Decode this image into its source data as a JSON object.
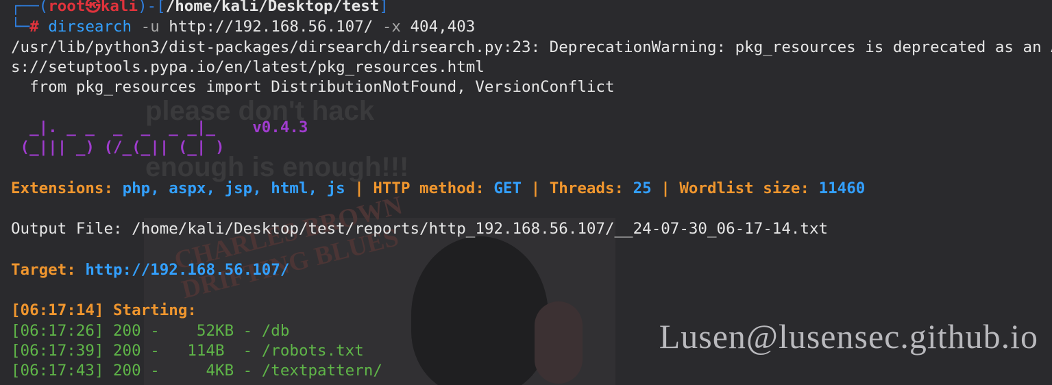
{
  "prompt": {
    "corner_top": "┌──(",
    "user": "root",
    "at_symbol": "㉿",
    "host": "kali",
    "dash_open": ")-[",
    "cwd": "/home/kali/Desktop/test",
    "close": "]",
    "corner_bottom": "└─",
    "hash": "#"
  },
  "command": {
    "program": "dirsearch",
    "flag_u": "-u",
    "url": "http://192.168.56.107/",
    "flag_x": "-x",
    "codes": "404,403"
  },
  "warning": {
    "line1": "/usr/lib/python3/dist-packages/dirsearch/dirsearch.py:23: DeprecationWarning: pkg_resources is deprecated as an API. See http",
    "line2": "s://setuptools.pypa.io/en/latest/pkg_resources.html",
    "line3": "  from pkg_resources import DistributionNotFound, VersionConflict"
  },
  "banner": {
    "art_line1": "  _|. _ _  _  _  _ _|_    ",
    "version": "v0.4.3",
    "art_line2": " (_||| _) (/_(_|| (_| )"
  },
  "config": {
    "ext_label": "Extensions:",
    "ext_value": "php, aspx, jsp, html, js",
    "sep": "|",
    "method_label": "HTTP method:",
    "method_value": "GET",
    "threads_label": "Threads:",
    "threads_value": "25",
    "wordlist_label": "Wordlist size:",
    "wordlist_value": "11460"
  },
  "output": {
    "label": "Output File:",
    "path": "/home/kali/Desktop/test/reports/http_192.168.56.107/__24-07-30_06-17-14.txt"
  },
  "target": {
    "label": "Target:",
    "url": "http://192.168.56.107/"
  },
  "starting": {
    "time": "[06:17:14]",
    "text": "Starting:"
  },
  "results": [
    {
      "time": "[06:17:26]",
      "status": "200",
      "size": "   52KB",
      "path": "/db"
    },
    {
      "time": "[06:17:39]",
      "status": "200",
      "size": "  114B ",
      "path": "/robots.txt"
    },
    {
      "time": "[06:17:43]",
      "status": "200",
      "size": "    4KB",
      "path": "/textpattern/"
    }
  ],
  "background": {
    "text1": "please don't hack",
    "text2": "enough is enough!!!",
    "poster_line1": "CHARLES BROWN",
    "poster_line2": "DRIFTING BLUES"
  },
  "watermark": "Lusen@lusensec.github.io",
  "colors": {
    "background": "#2a2a2d",
    "prompt_blue": "#2f7fe0",
    "prompt_red": "#e0333c",
    "orange": "#f0962e",
    "cyan": "#33a0ff",
    "purple": "#a03ccf",
    "green": "#5fb548"
  }
}
